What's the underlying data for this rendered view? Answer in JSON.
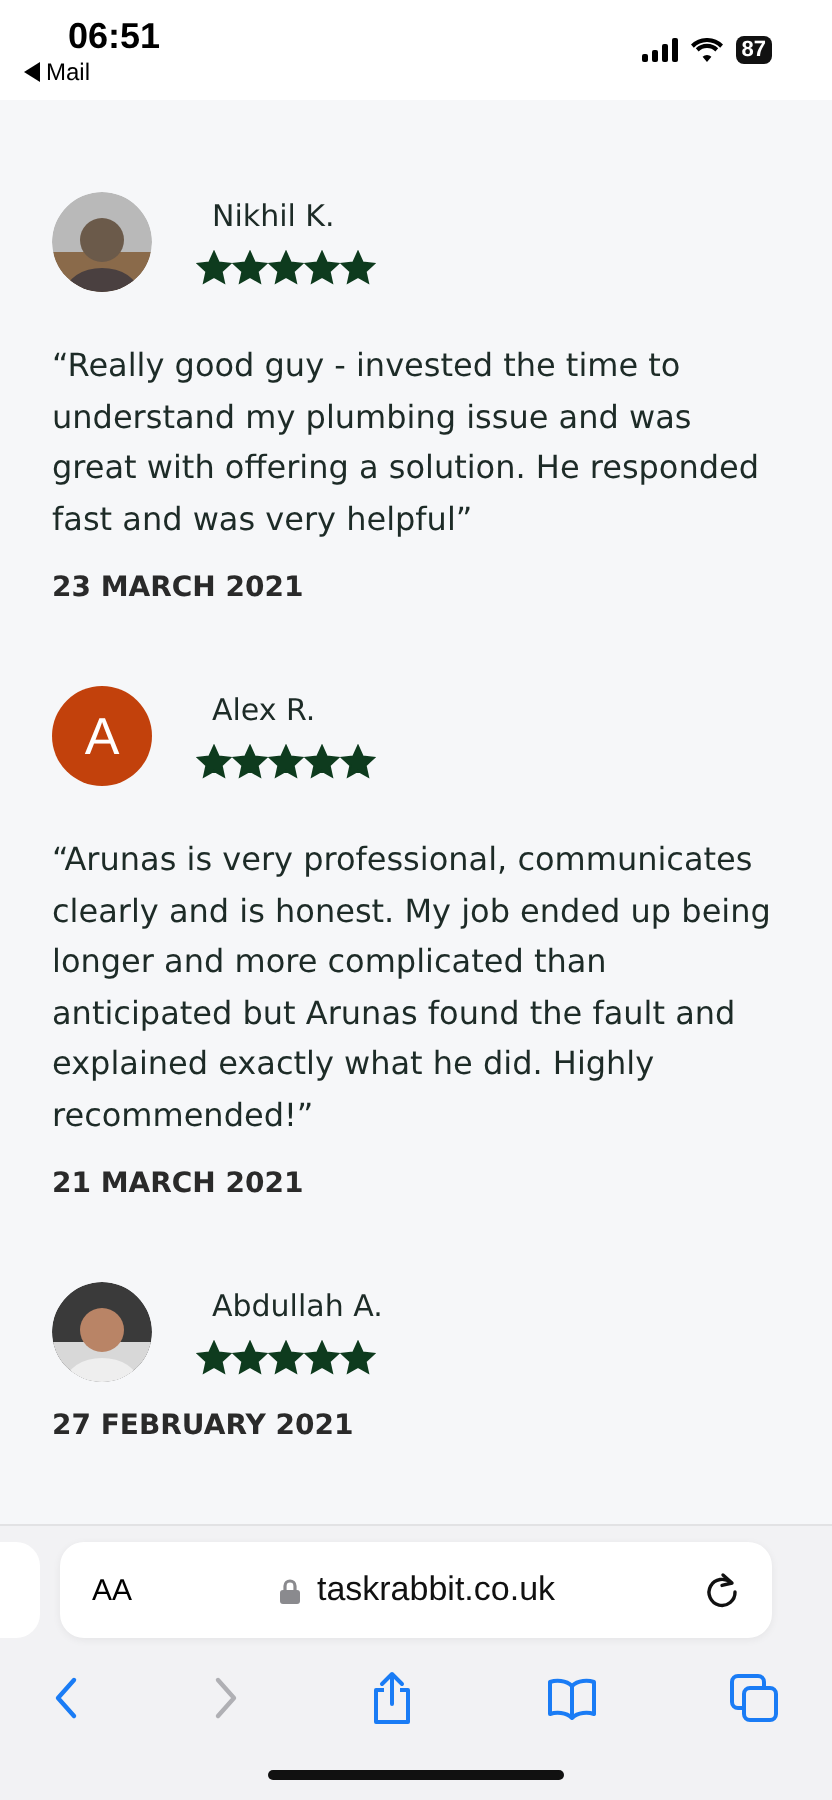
{
  "status_bar": {
    "time": "06:51",
    "back_label": "Mail",
    "battery": "87"
  },
  "reviews": [
    {
      "name": "Nikhil K.",
      "stars": 5,
      "text": "“Really good guy - invested the time to understand my plumbing issue and was great with offering a solution. He responded fast and was very helpful”",
      "date": "23 MARCH 2021"
    },
    {
      "name": "Alex R.",
      "avatar": {
        "kind": "initial",
        "letter": "A",
        "color": "#c2410c"
      },
      "stars": 5,
      "text": "“Arunas is very professional, communicates clearly and is honest. My job ended up being longer and more complicated than anticipated but Arunas found the fault and explained exactly what he did. Highly recommended!”",
      "date": "21 MARCH 2021"
    },
    {
      "name": "Abdullah A.",
      "stars": 5,
      "date": "27 FEBRUARY 2021"
    }
  ],
  "browser": {
    "text_size": "AA",
    "url": "taskrabbit.co.uk"
  }
}
